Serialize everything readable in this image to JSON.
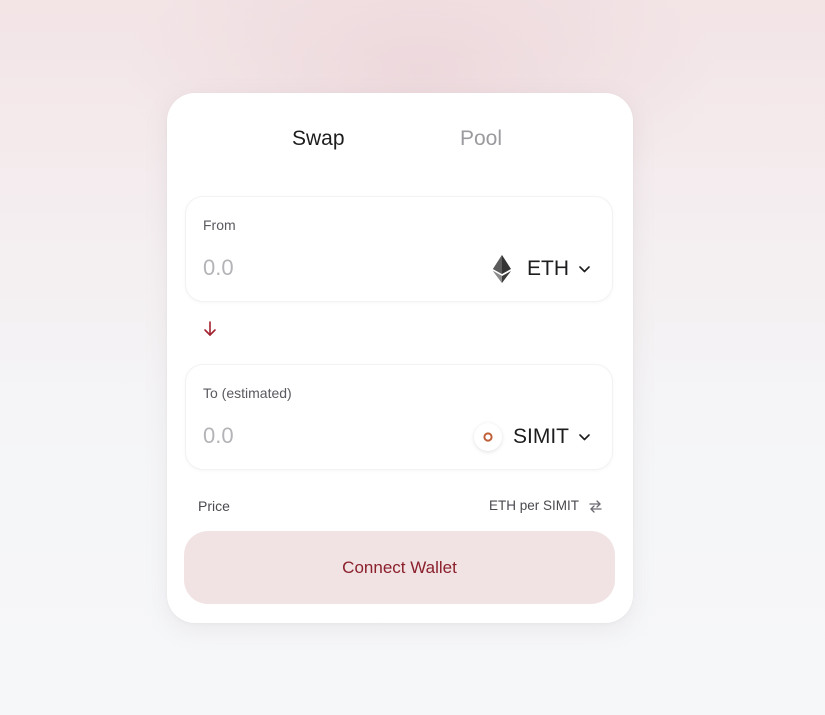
{
  "tabs": {
    "swap": "Swap",
    "pool": "Pool"
  },
  "from_panel": {
    "label": "From",
    "placeholder": "0.0",
    "token": {
      "symbol": "ETH",
      "icon": "ethereum-icon"
    }
  },
  "to_panel": {
    "label": "To (estimated)",
    "placeholder": "0.0",
    "token": {
      "symbol": "SIMIT",
      "icon": "simit-token-icon"
    }
  },
  "price": {
    "label": "Price",
    "unit": "ETH per SIMIT"
  },
  "connect_button": {
    "label": "Connect Wallet"
  },
  "colors": {
    "accent": "#8b1f2b",
    "button_bg": "#f1e3e4",
    "muted_text": "#b4b4b8"
  }
}
